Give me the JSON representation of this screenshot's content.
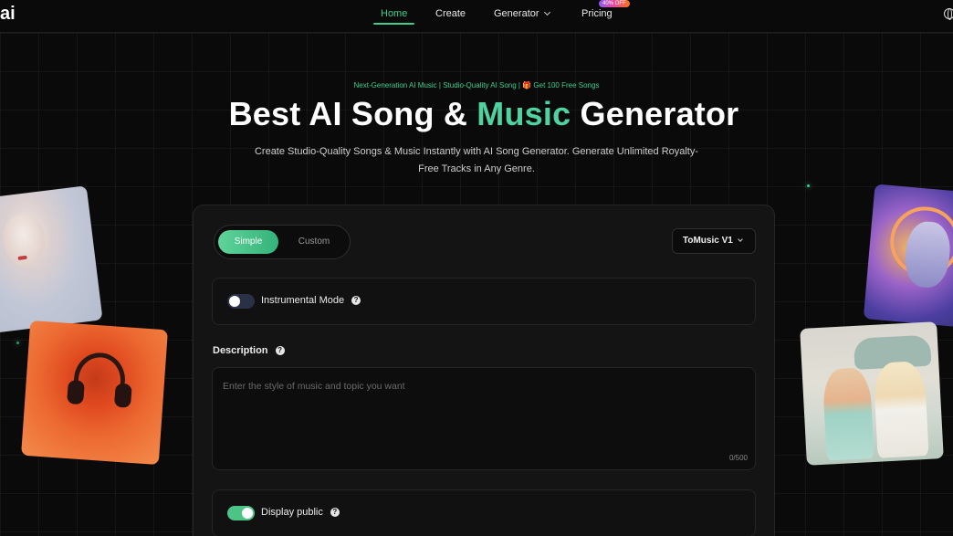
{
  "nav": {
    "logo": "ai",
    "items": [
      {
        "label": "Home",
        "active": true
      },
      {
        "label": "Create",
        "active": false
      },
      {
        "label": "Generator",
        "active": false
      },
      {
        "label": "Pricing",
        "active": false
      }
    ],
    "pricing_badge": "40% OFF"
  },
  "hero": {
    "tagline": "Next-Generation AI Music | Studio-Quality AI Song | 🎁 Get 100 Free Songs",
    "title_part1": "Best AI Song & ",
    "title_accent": "Music",
    "title_part2": " Generator",
    "subtitle": "Create Studio-Quality Songs & Music Instantly with AI Song Generator. Generate Unlimited Royalty-Free Tracks in Any Genre."
  },
  "form": {
    "modes": [
      "Simple",
      "Custom"
    ],
    "active_mode": "Simple",
    "model": "ToMusic V1",
    "instrumental_label": "Instrumental Mode",
    "instrumental_on": false,
    "description_label": "Description",
    "description_placeholder": "Enter the style of music and topic you want",
    "char_count": "0/500",
    "display_public_label": "Display public",
    "display_public_on": true,
    "help_glyph": "?"
  },
  "colors": {
    "accent": "#3ecf8e",
    "background": "#0a0a0a",
    "card": "#141414"
  }
}
